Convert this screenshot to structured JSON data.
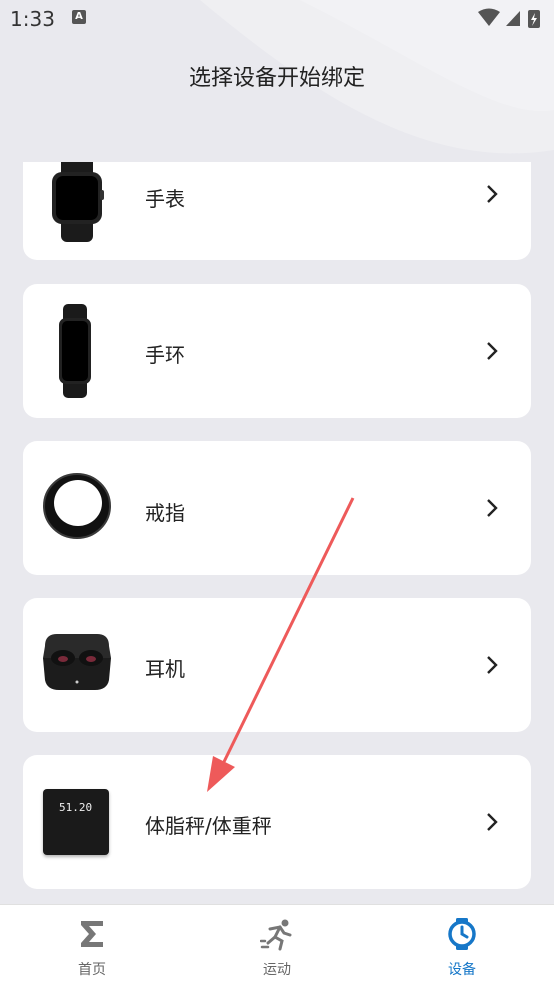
{
  "status_bar": {
    "time": "1:33",
    "notif_icon": "a-notification-icon"
  },
  "page": {
    "title": "选择设备开始绑定"
  },
  "devices": [
    {
      "label": "手表",
      "icon": "watch-icon"
    },
    {
      "label": "手环",
      "icon": "band-icon"
    },
    {
      "label": "戒指",
      "icon": "ring-icon"
    },
    {
      "label": "耳机",
      "icon": "earbuds-icon"
    },
    {
      "label": "体脂秤/体重秤",
      "icon": "scale-icon",
      "scale_reading": "51.20"
    }
  ],
  "tabs": [
    {
      "label": "首页",
      "icon": "sigma-home-icon",
      "active": false
    },
    {
      "label": "运动",
      "icon": "running-icon",
      "active": false
    },
    {
      "label": "设备",
      "icon": "watch-device-icon",
      "active": true
    }
  ],
  "colors": {
    "accent": "#1677c8",
    "annotation_arrow": "#ee5a5a"
  }
}
